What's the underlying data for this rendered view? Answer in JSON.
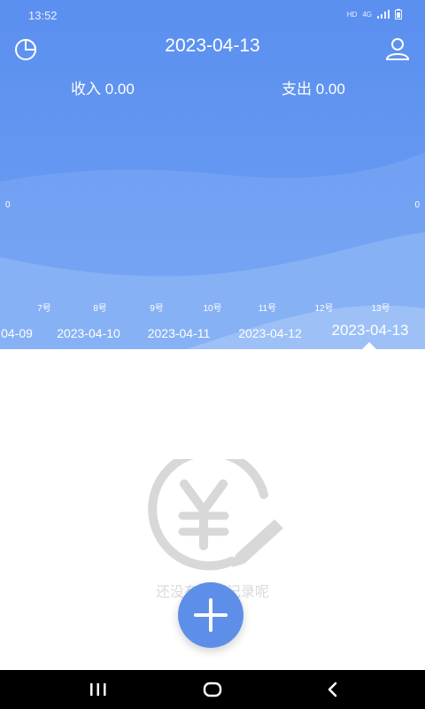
{
  "status_bar": {
    "time": "13:52",
    "hd": "HD",
    "network": "4G"
  },
  "header": {
    "title": "2023-04-13",
    "income_label": "收入",
    "income_value": "0.00",
    "expense_label": "支出",
    "expense_value": "0.00",
    "axis_left_value": "0",
    "axis_right_value": "0",
    "days": [
      "7号",
      "8号",
      "9号",
      "10号",
      "11号",
      "12号",
      "13号"
    ],
    "dates": [
      "04-09",
      "2023-04-10",
      "2023-04-11",
      "2023-04-12",
      "2023-04-13"
    ],
    "selected_date": "2023-04-13"
  },
  "icons": {
    "stats": "pie-chart-icon",
    "profile": "user-icon",
    "empty": "yen-pencil-icon",
    "fab": "plus-icon"
  },
  "empty_state": {
    "message": "还没有记账记录呢"
  },
  "colors": {
    "primary": "#5b8ff0",
    "fab": "#5e8fe8",
    "empty_icon": "#d8d8d8"
  },
  "nav": {
    "buttons": [
      "recent-apps",
      "home",
      "back"
    ]
  }
}
